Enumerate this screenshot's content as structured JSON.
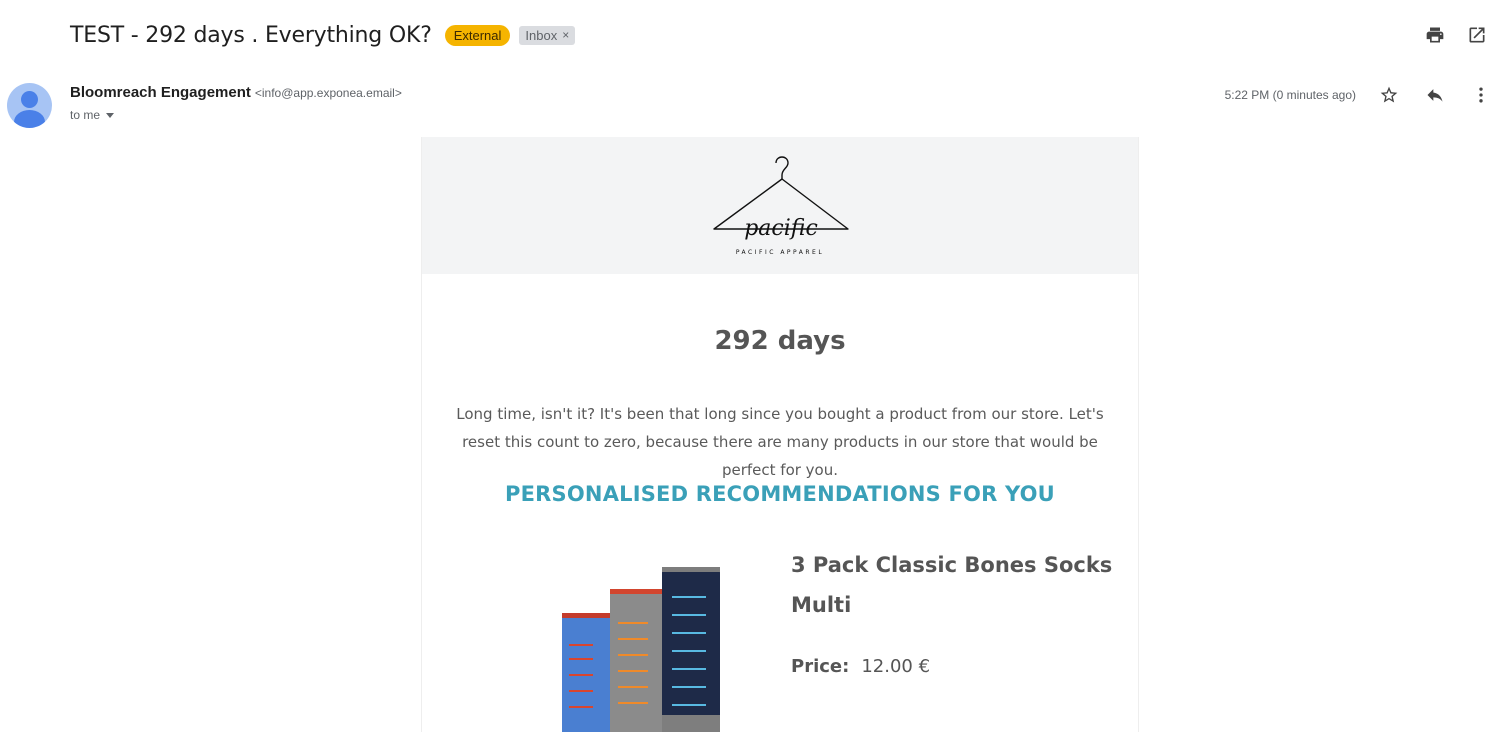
{
  "email": {
    "subject": "TEST - 292 days . Everything OK?",
    "labels": {
      "external": "External",
      "inbox": "Inbox"
    },
    "sender": {
      "name": "Bloomreach Engagement",
      "email": "<info@app.exponea.email>"
    },
    "recipient": "to me",
    "timestamp": "5:22 PM (0 minutes ago)"
  },
  "body": {
    "logo_text": "pacific",
    "logo_caption": "PACIFIC APPAREL",
    "headline": "292 days",
    "intro": "Long time, isn't it? It's been that long since you bought a product from our store. Let's reset this count to zero, because there are many products in our store that would be perfect for you.",
    "recommendations_heading": "PERSONALISED RECOMMENDATIONS FOR YOU",
    "product": {
      "title": "3 Pack Classic Bones Socks Multi",
      "price_label": "Price:",
      "price_value": "12.00 €"
    }
  },
  "colors": {
    "external_badge": "#f5b400",
    "accent_heading": "#3aa0b8",
    "header_bg": "#f3f4f5"
  },
  "icons": {
    "print": "print-icon",
    "open_new": "open-in-new-window-icon",
    "star": "star-icon",
    "reply": "reply-icon",
    "more": "more-vert-icon"
  }
}
